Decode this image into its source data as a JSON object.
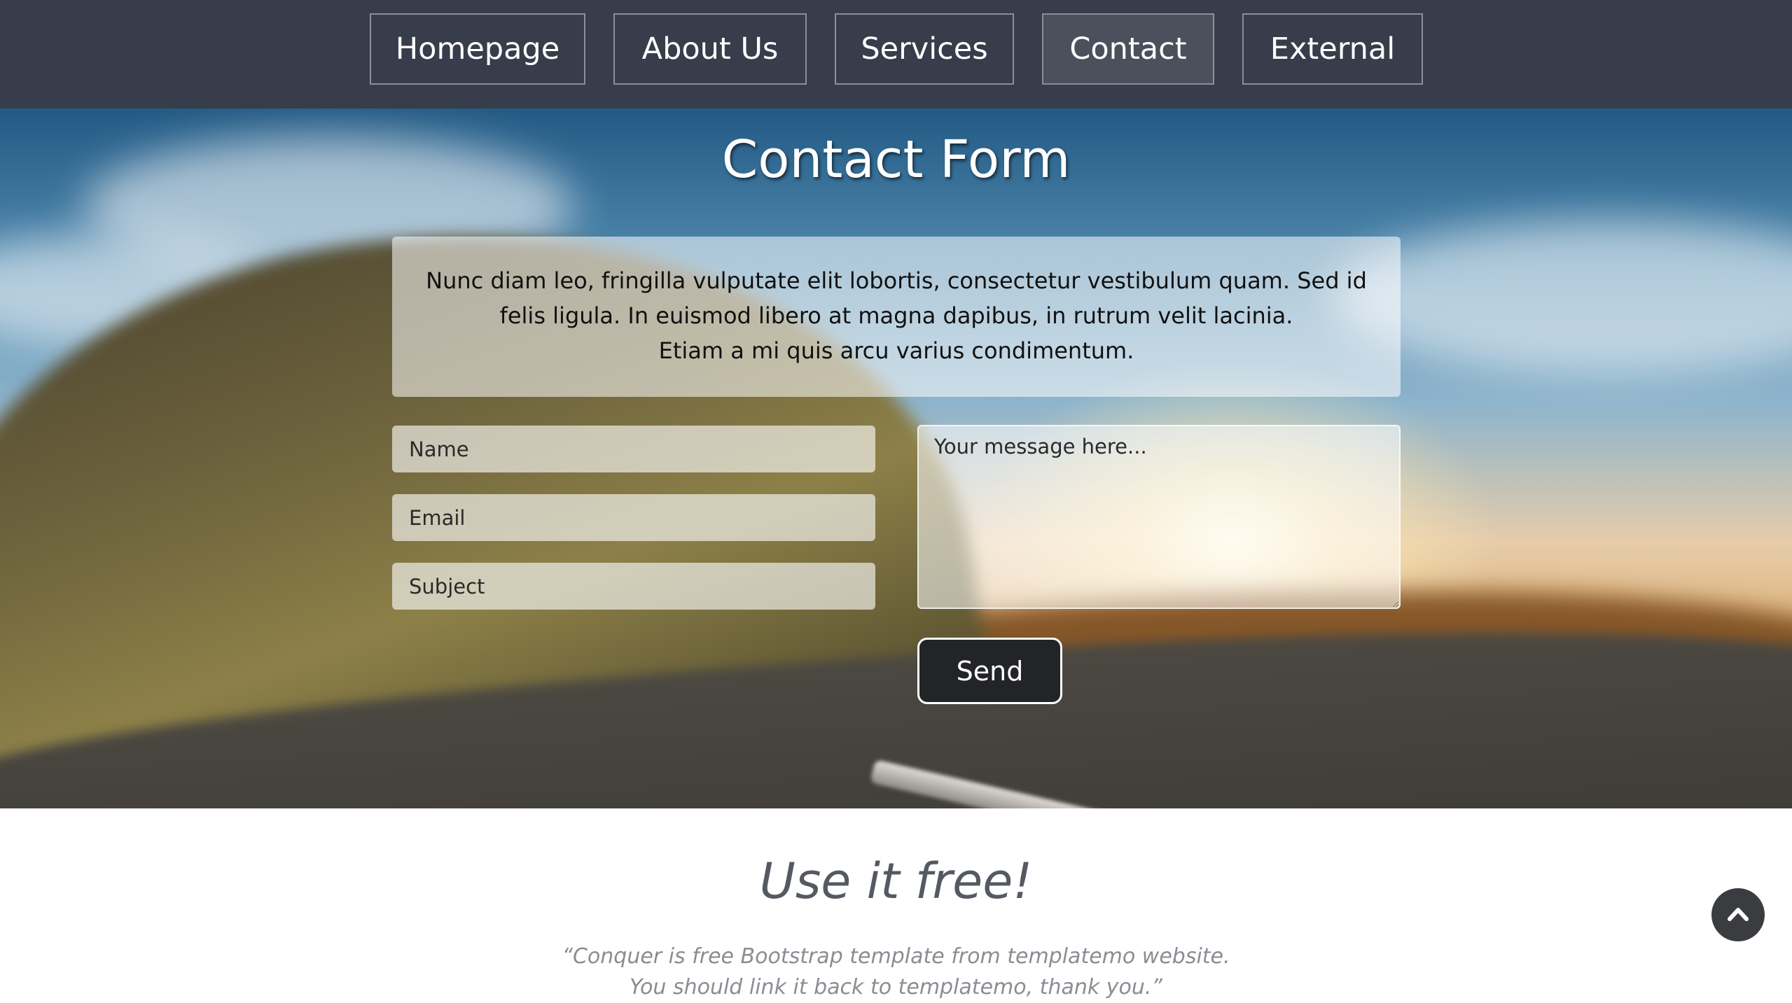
{
  "nav": {
    "items": [
      {
        "label": "Homepage"
      },
      {
        "label": "About Us"
      },
      {
        "label": "Services"
      },
      {
        "label": "Contact"
      },
      {
        "label": "External"
      }
    ],
    "active": "Contact"
  },
  "contact": {
    "title": "Contact Form",
    "intro_lines": [
      "Nunc diam leo, fringilla vulputate elit lobortis, consectetur vestibulum quam. Sed id",
      "felis ligula. In euismod libero at magna dapibus, in rutrum velit lacinia.",
      "Etiam a mi quis arcu varius condimentum."
    ],
    "name_placeholder": "Name",
    "email_placeholder": "Email",
    "subject_placeholder": "Subject",
    "message_placeholder": "Your message here...",
    "send_label": "Send"
  },
  "free": {
    "title": "Use it free!",
    "quote_lines": [
      "“Conquer is free Bootstrap template from templatemo website.",
      "You should link it back to templatemo, thank you.”"
    ]
  },
  "icons": {
    "back_to_top": "chevron-up-icon"
  },
  "colors": {
    "navbar": "#373d4a",
    "send_button": "#232428",
    "heading_gray": "#555a62"
  }
}
